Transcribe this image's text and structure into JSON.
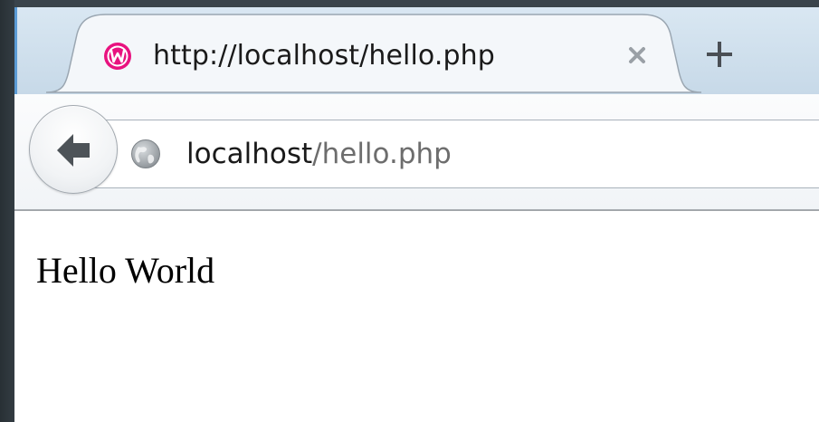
{
  "tab": {
    "title": "http://localhost/hello.php",
    "favicon": "wampserver-icon",
    "favicon_color": "#e8127f"
  },
  "toolbar": {
    "newtab_icon": "plus-icon",
    "back_icon": "back-arrow-icon"
  },
  "address_bar": {
    "host": "localhost",
    "path": "/hello.php",
    "site_icon": "globe-icon"
  },
  "page": {
    "body_text": "Hello World"
  },
  "colors": {
    "accent": "#5b9bd5",
    "url_path": "#6d6d6d"
  }
}
